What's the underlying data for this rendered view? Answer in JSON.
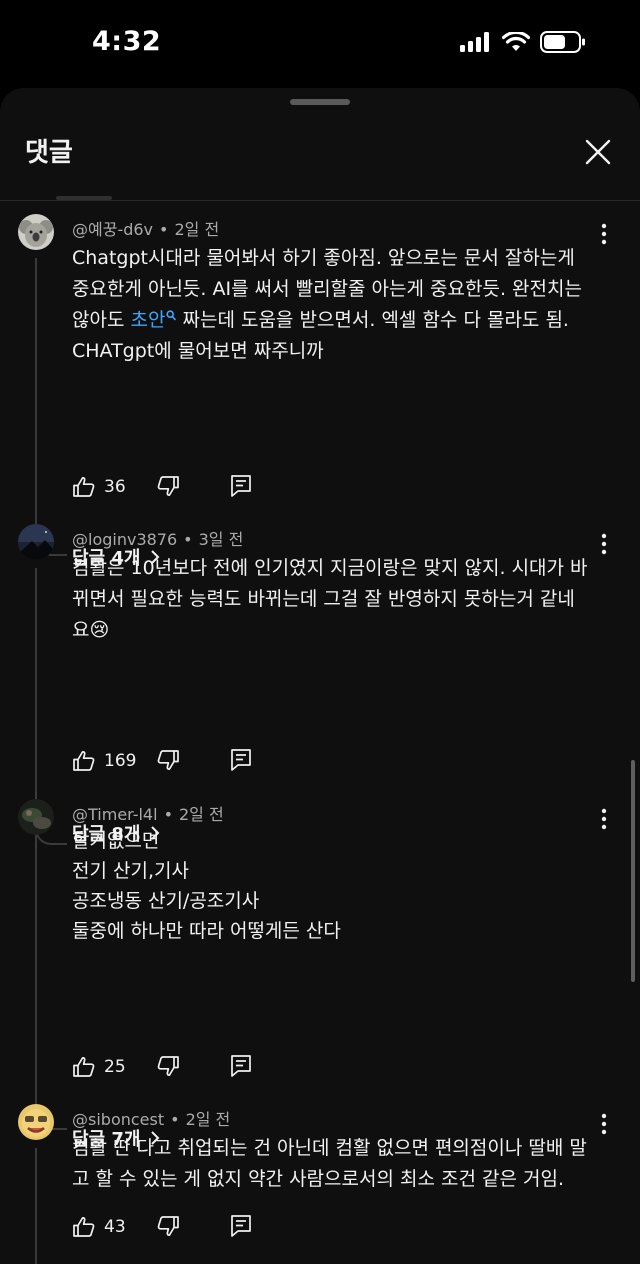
{
  "status_bar": {
    "time": "4:32"
  },
  "sheet": {
    "title": "댓글"
  },
  "comments": [
    {
      "author": "@예꿍-d6v",
      "age": "2일 전",
      "lines": [
        "Chatgpt시대라 물어봐서 하기 좋아짐. 앞으로는 문서 잘하는게",
        "중요한게 아닌듯. AI를 써서 빨리할줄 아는게 중요한듯. 완전치는",
        "않아도 ",
        "CHATgpt에 물어보면 짜주니까"
      ],
      "line3_link": "초안",
      "line3_rest": " 짜는데 도움을 받으면서. 엑셀 함수 다 몰라도 됨.",
      "likes": "36",
      "replies": "답글 4개"
    },
    {
      "author": "@loginv3876",
      "age": "3일 전",
      "lines": [
        "컴활은 10년보다 전에 인기였지 지금이랑은 맞지 않지. 시대가 바",
        "뀌면서 필요한 능력도 바뀌는데 그걸 잘 반영하지 못하는거 같네",
        "요😢"
      ],
      "likes": "169",
      "replies": "답글 8개"
    },
    {
      "author": "@Timer-l4l",
      "age": "2일 전",
      "lines": [
        "할거없으면",
        "전기 산기,기사",
        "공조냉동 산기/공조기사",
        "둘중에 하나만 따라 어떻게든 산다"
      ],
      "likes": "25",
      "replies": "답글 7개"
    },
    {
      "author": "@siboncest",
      "age": "2일 전",
      "lines": [
        "컴활 딴 다고 취업되는 건 아닌데 컴활 없으면 편의점이나 딸배 말",
        "고 할 수 있는 게 없지 약간 사람으로서의 최소 조건 같은 거임."
      ],
      "likes": "43"
    }
  ],
  "icons": {
    "signal": "cellular-signal-icon",
    "wifi": "wifi-icon",
    "battery": "battery-icon",
    "close": "close-icon",
    "more": "more-vert-icon",
    "like": "thumbs-up-icon",
    "dislike": "thumbs-down-icon",
    "reply": "reply-comment-icon",
    "chevron": "chevron-right-icon",
    "search": "search-icon"
  },
  "colors": {
    "background": "#0f0f0f",
    "text": "#f1f1f1",
    "secondary": "#aaaaaa",
    "link": "#3ea6ff"
  }
}
